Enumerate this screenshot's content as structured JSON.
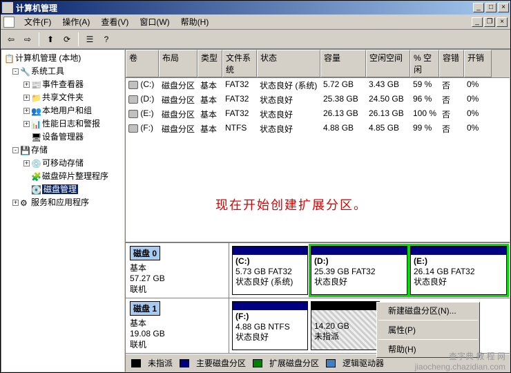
{
  "title": "计算机管理",
  "menu": {
    "file": "文件(F)",
    "action": "操作(A)",
    "view": "查看(V)",
    "window": "窗口(W)",
    "help": "帮助(H)"
  },
  "tree": {
    "root": "计算机管理 (本地)",
    "systools": "系统工具",
    "eventviewer": "事件查看器",
    "shared": "共享文件夹",
    "users": "本地用户和组",
    "perf": "性能日志和警报",
    "devmgr": "设备管理器",
    "storage": "存储",
    "removable": "可移动存储",
    "defrag": "磁盘碎片整理程序",
    "diskmgmt": "磁盘管理",
    "services": "服务和应用程序"
  },
  "grid": {
    "headers": [
      "卷",
      "布局",
      "类型",
      "文件系统",
      "状态",
      "容量",
      "空闲空间",
      "% 空闲",
      "容错",
      "开销"
    ],
    "rows": [
      {
        "vol": "(C:)",
        "layout": "磁盘分区",
        "type": "基本",
        "fs": "FAT32",
        "status": "状态良好 (系统)",
        "cap": "5.72 GB",
        "free": "3.43 GB",
        "pct": "59 %",
        "ft": "否",
        "oh": "0%"
      },
      {
        "vol": "(D:)",
        "layout": "磁盘分区",
        "type": "基本",
        "fs": "FAT32",
        "status": "状态良好",
        "cap": "25.38 GB",
        "free": "24.50 GB",
        "pct": "96 %",
        "ft": "否",
        "oh": "0%"
      },
      {
        "vol": "(E:)",
        "layout": "磁盘分区",
        "type": "基本",
        "fs": "FAT32",
        "status": "状态良好",
        "cap": "26.13 GB",
        "free": "26.13 GB",
        "pct": "100 %",
        "ft": "否",
        "oh": "0%"
      },
      {
        "vol": "(F:)",
        "layout": "磁盘分区",
        "type": "基本",
        "fs": "NTFS",
        "status": "状态良好",
        "cap": "4.88 GB",
        "free": "4.85 GB",
        "pct": "99 %",
        "ft": "否",
        "oh": "0%"
      }
    ]
  },
  "annotation": "现在开始创建扩展分区。",
  "disks": {
    "d0": {
      "title": "磁盘 0",
      "type": "基本",
      "size": "57.27 GB",
      "status": "联机"
    },
    "d1": {
      "title": "磁盘 1",
      "type": "基本",
      "size": "19.08 GB",
      "status": "联机"
    },
    "p_c": {
      "name": "(C:)",
      "info": "5.73 GB FAT32",
      "status": "状态良好 (系统)"
    },
    "p_d": {
      "name": "(D:)",
      "info": "25.39 GB FAT32",
      "status": "状态良好"
    },
    "p_e": {
      "name": "(E:)",
      "info": "26.14 GB FAT32",
      "status": "状态良好"
    },
    "p_f": {
      "name": "(F:)",
      "info": "4.88 GB NTFS",
      "status": "状态良好"
    },
    "p_u": {
      "name": "",
      "info": "14.20 GB",
      "status": "未指派"
    }
  },
  "legend": {
    "unalloc": "未指派",
    "primary": "主要磁盘分区",
    "extended": "扩展磁盘分区",
    "logical": "逻辑驱动器"
  },
  "ctx": {
    "newpart": "新建磁盘分区(N)...",
    "props": "属性(P)",
    "help": "帮助(H)"
  },
  "colors": {
    "titlebar": "#0a246a",
    "unalloc": "#000000",
    "primary": "#000080",
    "extended": "#008000",
    "logical": "#4080c0",
    "highlight": "#00dd00",
    "annotation": "#cc0000"
  },
  "watermark": {
    "l1": "查字典  教 程 网",
    "l2": "jiaocheng.chazidian.com"
  }
}
